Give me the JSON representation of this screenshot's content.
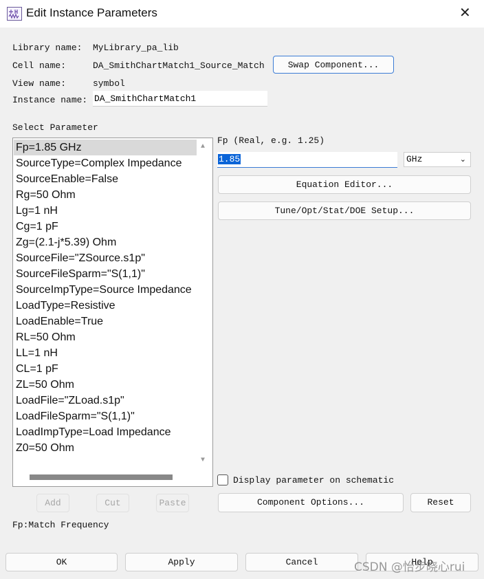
{
  "window": {
    "title": "Edit Instance Parameters",
    "icon": "schematic-app-icon",
    "close_icon": "close-icon"
  },
  "info": {
    "library_label": "Library name:",
    "library_value": "MyLibrary_pa_lib",
    "cell_label": "Cell name:",
    "cell_value": "DA_SmithChartMatch1_Source_Match",
    "view_label": "View name:",
    "view_value": "symbol",
    "instance_label": "Instance name:",
    "instance_value": "DA_SmithChartMatch1",
    "swap_button": "Swap Component..."
  },
  "params": {
    "label": "Select Parameter",
    "selected_index": 0,
    "items": [
      "Fp=1.85 GHz",
      "SourceType=Complex Impedance",
      "SourceEnable=False",
      "Rg=50 Ohm",
      "Lg=1 nH",
      "Cg=1 pF",
      "Zg=(2.1-j*5.39) Ohm",
      "SourceFile=\"ZSource.s1p\"",
      "SourceFileSparm=\"S(1,1)\"",
      "SourceImpType=Source Impedance",
      "LoadType=Resistive",
      "LoadEnable=True",
      "RL=50 Ohm",
      "LL=1 nH",
      "CL=1 pF",
      "ZL=50 Ohm",
      "LoadFile=\"ZLoad.s1p\"",
      "LoadFileSparm=\"S(1,1)\"",
      "LoadImpType=Load Impedance",
      "Z0=50 Ohm"
    ],
    "add": "Add",
    "cut": "Cut",
    "paste": "Paste"
  },
  "editor": {
    "hint": "Fp (Real, e.g. 1.25)",
    "value": "1.85",
    "unit": "GHz",
    "equation_editor": "Equation Editor...",
    "tune_setup": "Tune/Opt/Stat/DOE Setup...",
    "display_checkbox": "Display parameter on schematic",
    "display_checked": false,
    "component_options": "Component Options...",
    "reset": "Reset"
  },
  "description": "Fp:Match Frequency",
  "footer": {
    "ok": "OK",
    "apply": "Apply",
    "cancel": "Cancel",
    "help": "Help"
  },
  "watermark": "CSDN @怡步晓心rui"
}
